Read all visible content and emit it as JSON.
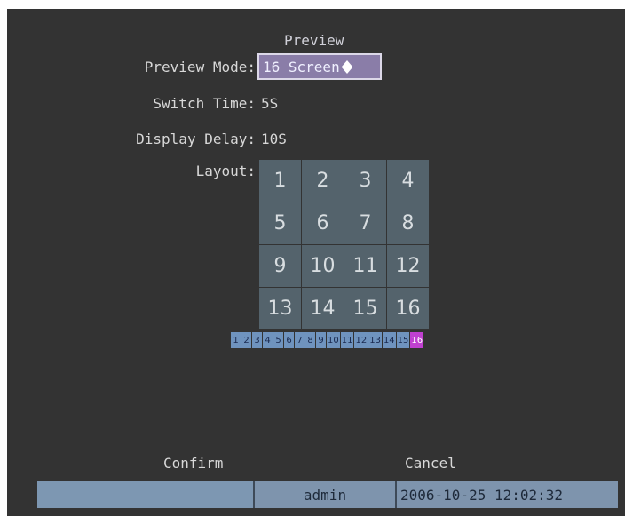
{
  "dialog": {
    "title": "Preview"
  },
  "form": {
    "preview_mode_label": "Preview Mode:",
    "preview_mode_value": "16 Screen",
    "switch_time_label": "Switch Time:",
    "switch_time_value": "5S",
    "display_delay_label": "Display Delay:",
    "display_delay_value": "10S",
    "layout_label": "Layout:"
  },
  "layout_grid": [
    "1",
    "2",
    "3",
    "4",
    "5",
    "6",
    "7",
    "8",
    "9",
    "10",
    "11",
    "12",
    "13",
    "14",
    "15",
    "16"
  ],
  "channel_strip": {
    "items": [
      "1",
      "2",
      "3",
      "4",
      "5",
      "6",
      "7",
      "8",
      "9",
      "10",
      "11",
      "12",
      "13",
      "14",
      "15",
      "16"
    ],
    "selected": "16"
  },
  "buttons": {
    "confirm": "Confirm",
    "cancel": "Cancel"
  },
  "status_bar": {
    "user": "admin",
    "datetime": "2006-10-25 12:02:32"
  },
  "colors": {
    "background": "#333333",
    "grid_cell": "#54636c",
    "select_bg": "#8a7da8",
    "chip": "#6f93be",
    "chip_active": "#c040d0",
    "status_bar": "#7e94ad"
  }
}
